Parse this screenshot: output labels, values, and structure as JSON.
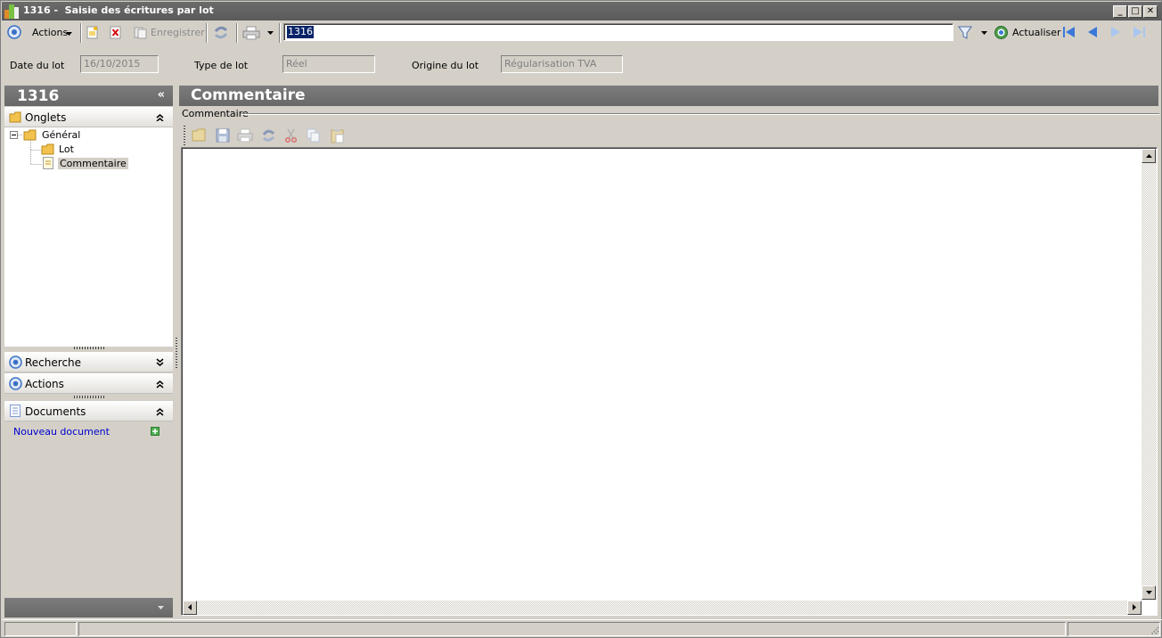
{
  "window": {
    "title": "1316 -  Saisie des écritures par lot",
    "minimize": "_",
    "maximize": "□",
    "close": "✕"
  },
  "toolbar": {
    "actions_label": "Actions",
    "save_label": "Enregistrer",
    "record_value": "1316",
    "refresh_label": "Actualiser"
  },
  "header_fields": [
    {
      "label": "Date du lot",
      "value": "16/10/2015"
    },
    {
      "label": "Type de lot",
      "value": "Réel"
    },
    {
      "label": "Origine du lot",
      "value": "Régularisation TVA"
    }
  ],
  "left_panel": {
    "title": "1316",
    "collapse_glyph": "«",
    "groups": {
      "onglets": "Onglets",
      "recherche": "Recherche",
      "actions": "Actions",
      "documents": "Documents"
    },
    "tree": {
      "root": "Général",
      "children": [
        "Lot",
        "Commentaire"
      ],
      "expander": "−"
    },
    "new_document_link": "Nouveau document"
  },
  "main": {
    "header_title": "Commentaire",
    "group_legend": "Commentaire"
  },
  "icons": {
    "app": "app-icon",
    "actions": "target-icon",
    "new": "new-document-icon",
    "delete": "delete-icon",
    "save": "save-icon",
    "refresh": "refresh-icon",
    "print": "printer-icon",
    "filter": "filter-icon",
    "first": "first-record-icon",
    "previous": "previous-record-icon",
    "next": "next-record-icon",
    "last": "last-record-icon"
  },
  "colors": {
    "titlebar": "#5a5a5a",
    "panel_header": "#707070",
    "nav_blue": "#3a78d8",
    "link": "#0000cc",
    "selection": "#0a246a"
  }
}
